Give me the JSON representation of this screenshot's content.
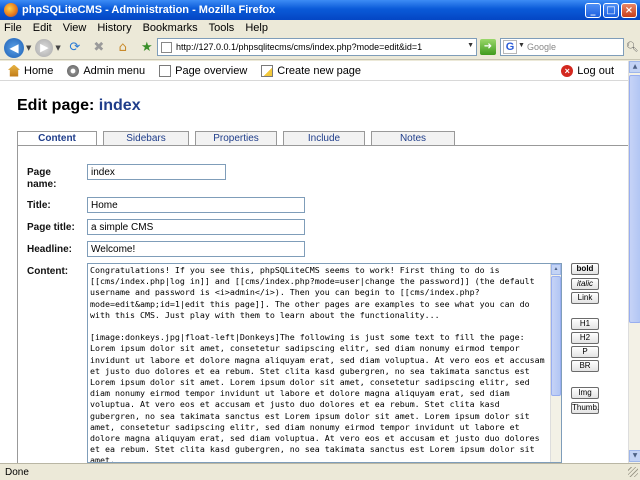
{
  "window": {
    "title": "phpSQLiteCMS - Administration - Mozilla Firefox"
  },
  "menu": [
    "File",
    "Edit",
    "View",
    "History",
    "Bookmarks",
    "Tools",
    "Help"
  ],
  "nav": {
    "url": "http://127.0.0.1/phpsqlitecms/cms/index.php?mode=edit&id=1",
    "search_placeholder": "Google"
  },
  "adminbar": {
    "home": "Home",
    "admin_menu": "Admin menu",
    "page_overview": "Page overview",
    "create_new_page": "Create new page",
    "logout": "Log out"
  },
  "heading": {
    "prefix": "Edit page:",
    "page": "index"
  },
  "tabs": [
    "Content",
    "Sidebars",
    "Properties",
    "Include",
    "Notes"
  ],
  "form": {
    "page_name_label": "Page name:",
    "page_name": "index",
    "title_label": "Title:",
    "title": "Home",
    "page_title_label": "Page title:",
    "page_title": "a simple CMS",
    "headline_label": "Headline:",
    "headline": "Welcome!",
    "content_label": "Content:",
    "content": "Congratulations! If you see this, phpSQLiteCMS seems to work! First thing to do is [[cms/index.php|log in]] and [[cms/index.php?mode=user|change the password]] (the default username and password is <i>admin</i>). Then you can begin to [[cms/index.php?mode=edit&amp;id=1|edit this page]]. The other pages are examples to see what you can do with this CMS. Just play with them to learn about the functionality...\n\n[image:donkeys.jpg|float-left|Donkeys]The following is just some text to fill the page: Lorem ipsum dolor sit amet, consetetur sadipscing elitr, sed diam nonumy eirmod tempor invidunt ut labore et dolore magna aliquyam erat, sed diam voluptua. At vero eos et accusam et justo duo dolores et ea rebum. Stet clita kasd gubergren, no sea takimata sanctus est Lorem ipsum dolor sit amet. Lorem ipsum dolor sit amet, consetetur sadipscing elitr, sed diam nonumy eirmod tempor invidunt ut labore et dolore magna aliquyam erat, sed diam voluptua. At vero eos et accusam et justo duo dolores et ea rebum. Stet clita kasd gubergren, no sea takimata sanctus est Lorem ipsum dolor sit amet. Lorem ipsum dolor sit amet, consetetur sadipscing elitr, sed diam nonumy eirmod tempor invidunt ut labore et dolore magna aliquyam erat, sed diam voluptua. At vero eos et accusam et justo duo dolores et ea rebum. Stet clita kasd gubergren, no sea takimata sanctus est Lorem ipsum dolor sit amet."
  },
  "format_buttons": {
    "bold": "bold",
    "italic": "italic",
    "link": "Link",
    "h1": "H1",
    "h2": "H2",
    "p": "P",
    "br": "BR",
    "img": "Img",
    "thumb": "Thumb."
  },
  "status": "Done",
  "colors": {
    "heading_accent": "#1f3d8a",
    "titlebar": "#0a5ad8"
  }
}
